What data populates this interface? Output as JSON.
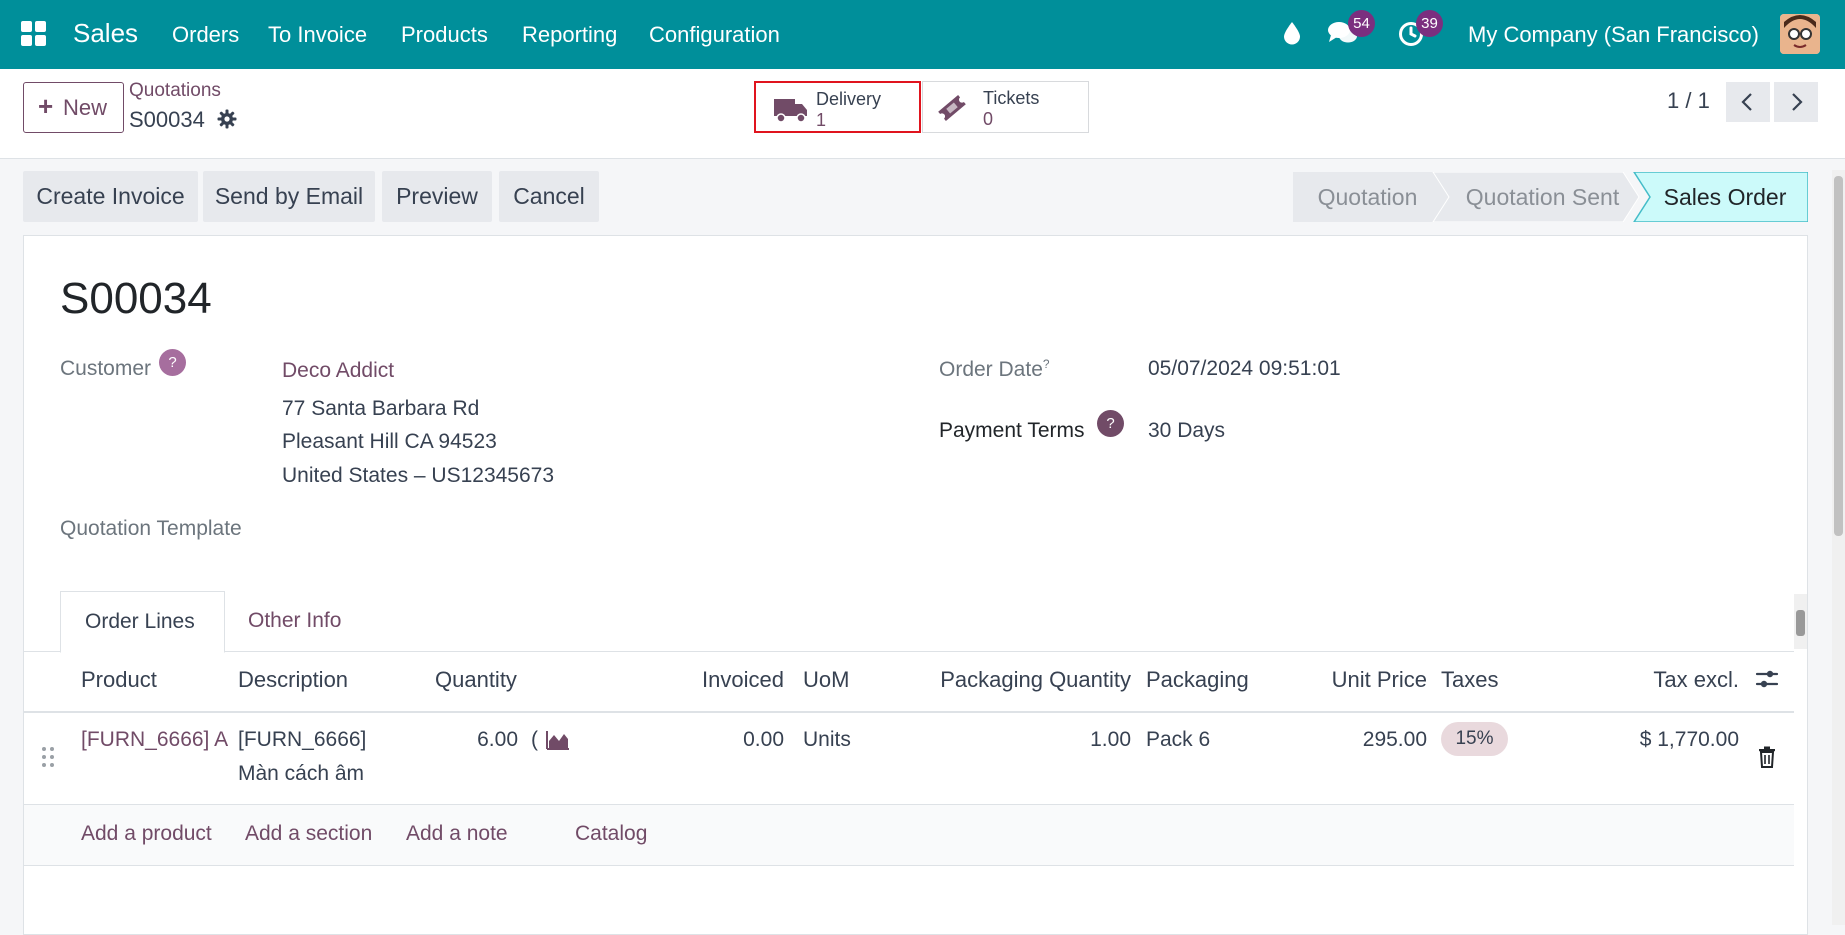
{
  "navbar": {
    "app_name": "Sales",
    "menus": [
      "Orders",
      "To Invoice",
      "Products",
      "Reporting",
      "Configuration"
    ],
    "messages_count": "54",
    "activities_count": "39",
    "company": "My Company (San Francisco)"
  },
  "control_panel": {
    "new_label": "New",
    "breadcrumb_parent": "Quotations",
    "record_name": "S00034",
    "smart_buttons": [
      {
        "label": "Delivery",
        "value": "1",
        "highlighted": true
      },
      {
        "label": "Tickets",
        "value": "0",
        "highlighted": false
      }
    ],
    "pager": "1 / 1"
  },
  "statusbar": {
    "buttons": [
      "Create Invoice",
      "Send by Email",
      "Preview",
      "Cancel"
    ],
    "stages": [
      "Quotation",
      "Quotation Sent",
      "Sales Order"
    ],
    "active_stage": "Sales Order"
  },
  "form": {
    "title": "S00034",
    "customer_label": "Customer",
    "customer_name": "Deco Addict",
    "address_line1": "77 Santa Barbara Rd",
    "address_line2": "Pleasant Hill CA 94523",
    "address_line3": "United States – US12345673",
    "order_date_label": "Order Date",
    "order_date_sup": "?",
    "order_date": "05/07/2024 09:51:01",
    "payment_terms_label": "Payment Terms",
    "payment_terms": "30 Days",
    "quotation_template_label": "Quotation Template",
    "help_mark": "?"
  },
  "tabs": [
    "Order Lines",
    "Other Info"
  ],
  "table": {
    "headers": [
      "Product",
      "Description",
      "Quantity",
      "Invoiced",
      "UoM",
      "Packaging Quantity",
      "Packaging",
      "Unit Price",
      "Taxes",
      "Tax excl."
    ],
    "rows": [
      {
        "product": "[FURN_6666] A",
        "description_line1": "[FURN_6666]",
        "description_line2": "Màn cách âm",
        "quantity": "6.00",
        "quantity_glyph": "(",
        "invoiced": "0.00",
        "uom": "Units",
        "packaging_qty": "1.00",
        "packaging": "Pack 6",
        "unit_price": "295.00",
        "taxes": "15%",
        "subtotal": "$ 1,770.00"
      }
    ],
    "add_links": [
      "Add a product",
      "Add a section",
      "Add a note",
      "Catalog"
    ]
  },
  "colors": {
    "navbar": "#008f9a",
    "brand": "#714b67",
    "active_stage_bg": "#ccfafa",
    "highlight_border": "#e0141e"
  }
}
